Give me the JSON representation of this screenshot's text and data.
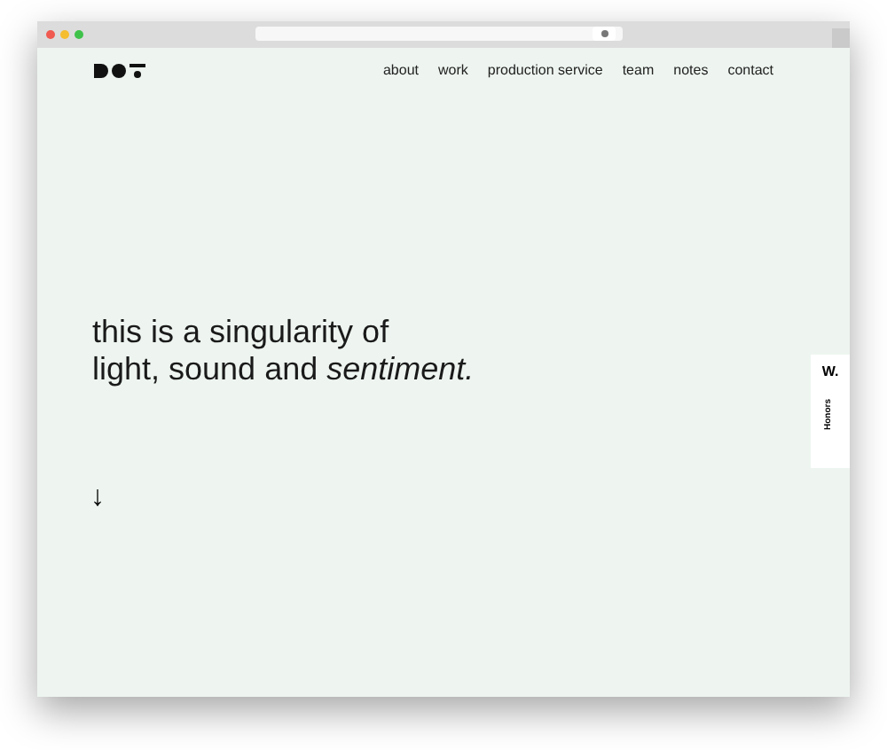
{
  "nav": {
    "items": [
      "about",
      "work",
      "production service",
      "team",
      "notes",
      "contact"
    ]
  },
  "hero": {
    "lines": [
      "this is a singularity of",
      "light, sound and *sentiment.*"
    ],
    "arrow": "↓"
  },
  "badge": {
    "mark": "W.",
    "label": "Honors"
  }
}
